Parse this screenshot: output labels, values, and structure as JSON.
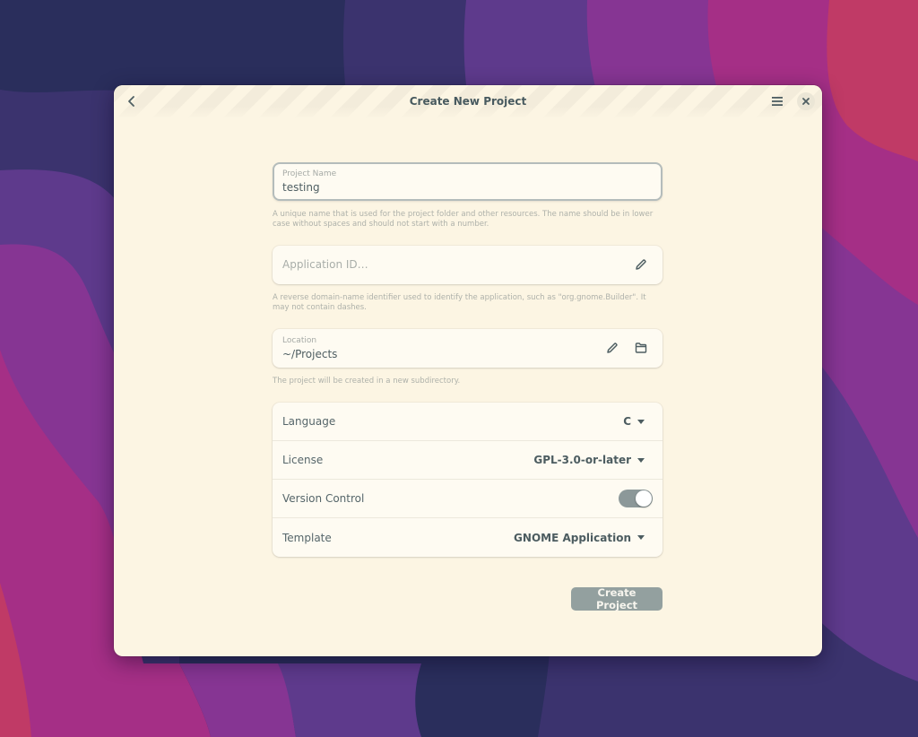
{
  "window": {
    "title": "Create New Project",
    "icons": {
      "back": "back-chevron-icon",
      "menu": "hamburger-menu-icon",
      "close": "close-icon"
    }
  },
  "form": {
    "project_name": {
      "label": "Project Name",
      "value": "testing",
      "hint": "A unique name that is used for the project folder and other resources. The name should be in lower case without spaces and should not start with a number."
    },
    "application_id": {
      "placeholder": "Application ID…",
      "value": "",
      "edit_icon": "pencil-icon",
      "hint": "A reverse domain-name identifier used to identify the application, such as \"org.gnome.Builder\". It may not contain dashes."
    },
    "location": {
      "label": "Location",
      "value": "~/Projects",
      "edit_icon": "pencil-icon",
      "browse_icon": "folder-icon",
      "hint": "The project will be created in a new subdirectory."
    },
    "options": {
      "language": {
        "label": "Language",
        "value": "C"
      },
      "license": {
        "label": "License",
        "value": "GPL-3.0-or-later"
      },
      "version_control": {
        "label": "Version Control",
        "enabled": true
      },
      "template": {
        "label": "Template",
        "value": "GNOME Application"
      }
    },
    "create_button": "Create Project"
  },
  "colors": {
    "window_bg": "#fcf5e3",
    "accent_button": "#93a09f",
    "text": "#4e5e62",
    "wallpaper": [
      "#2a2e5c",
      "#3b336e",
      "#5e3a8c",
      "#863593",
      "#a52f86",
      "#c03a66"
    ]
  }
}
